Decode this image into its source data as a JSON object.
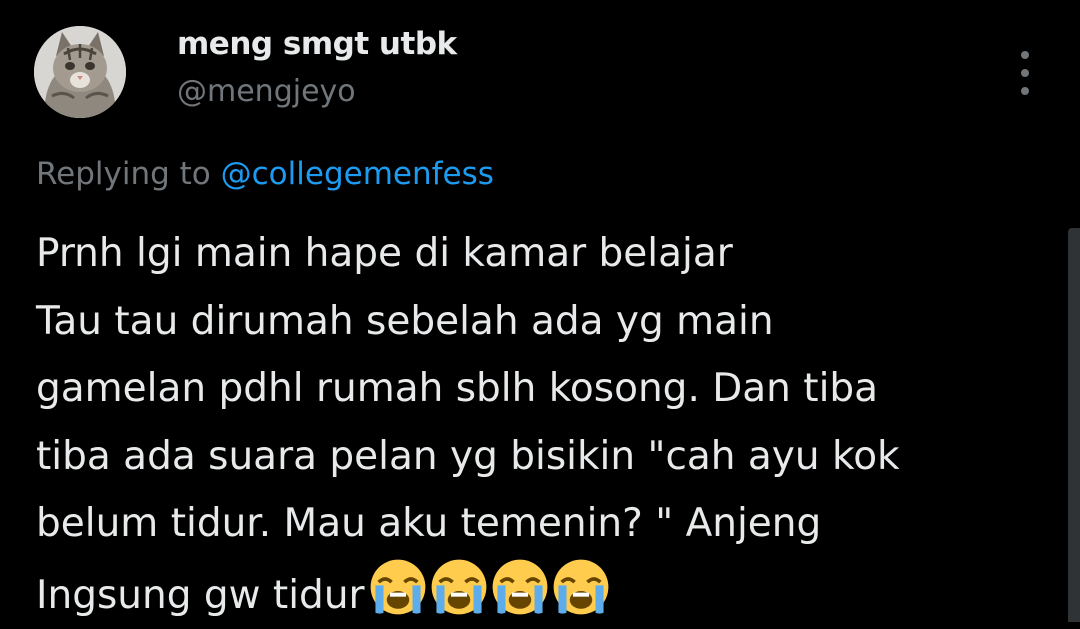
{
  "author": {
    "display_name": "meng smgt utbk",
    "handle": "@mengjeyo",
    "avatar_icon": "cat-avatar-icon"
  },
  "reply": {
    "prefix": "Replying to",
    "mention": "@collegemenfess"
  },
  "tweet": {
    "lines": [
      "Prnh lgi main hape di kamar belajar",
      "Tau tau dirumah sebelah ada yg main",
      "gamelan pdhl rumah sblh kosong. Dan tiba",
      "tiba ada suara pelan yg bisikin \"cah ayu kok",
      "belum tidur. Mau aku temenin? \" Anjeng",
      "Ingsung gw tidur"
    ],
    "trailing_emoji": [
      "loudly-crying-face-icon",
      "loudly-crying-face-icon",
      "loudly-crying-face-icon",
      "loudly-crying-face-icon"
    ]
  },
  "menu": {
    "icon": "more-vertical-icon"
  },
  "colors": {
    "background": "#000000",
    "text_primary": "#e7e9ea",
    "text_secondary": "#71767b",
    "link": "#1d9bf0"
  }
}
